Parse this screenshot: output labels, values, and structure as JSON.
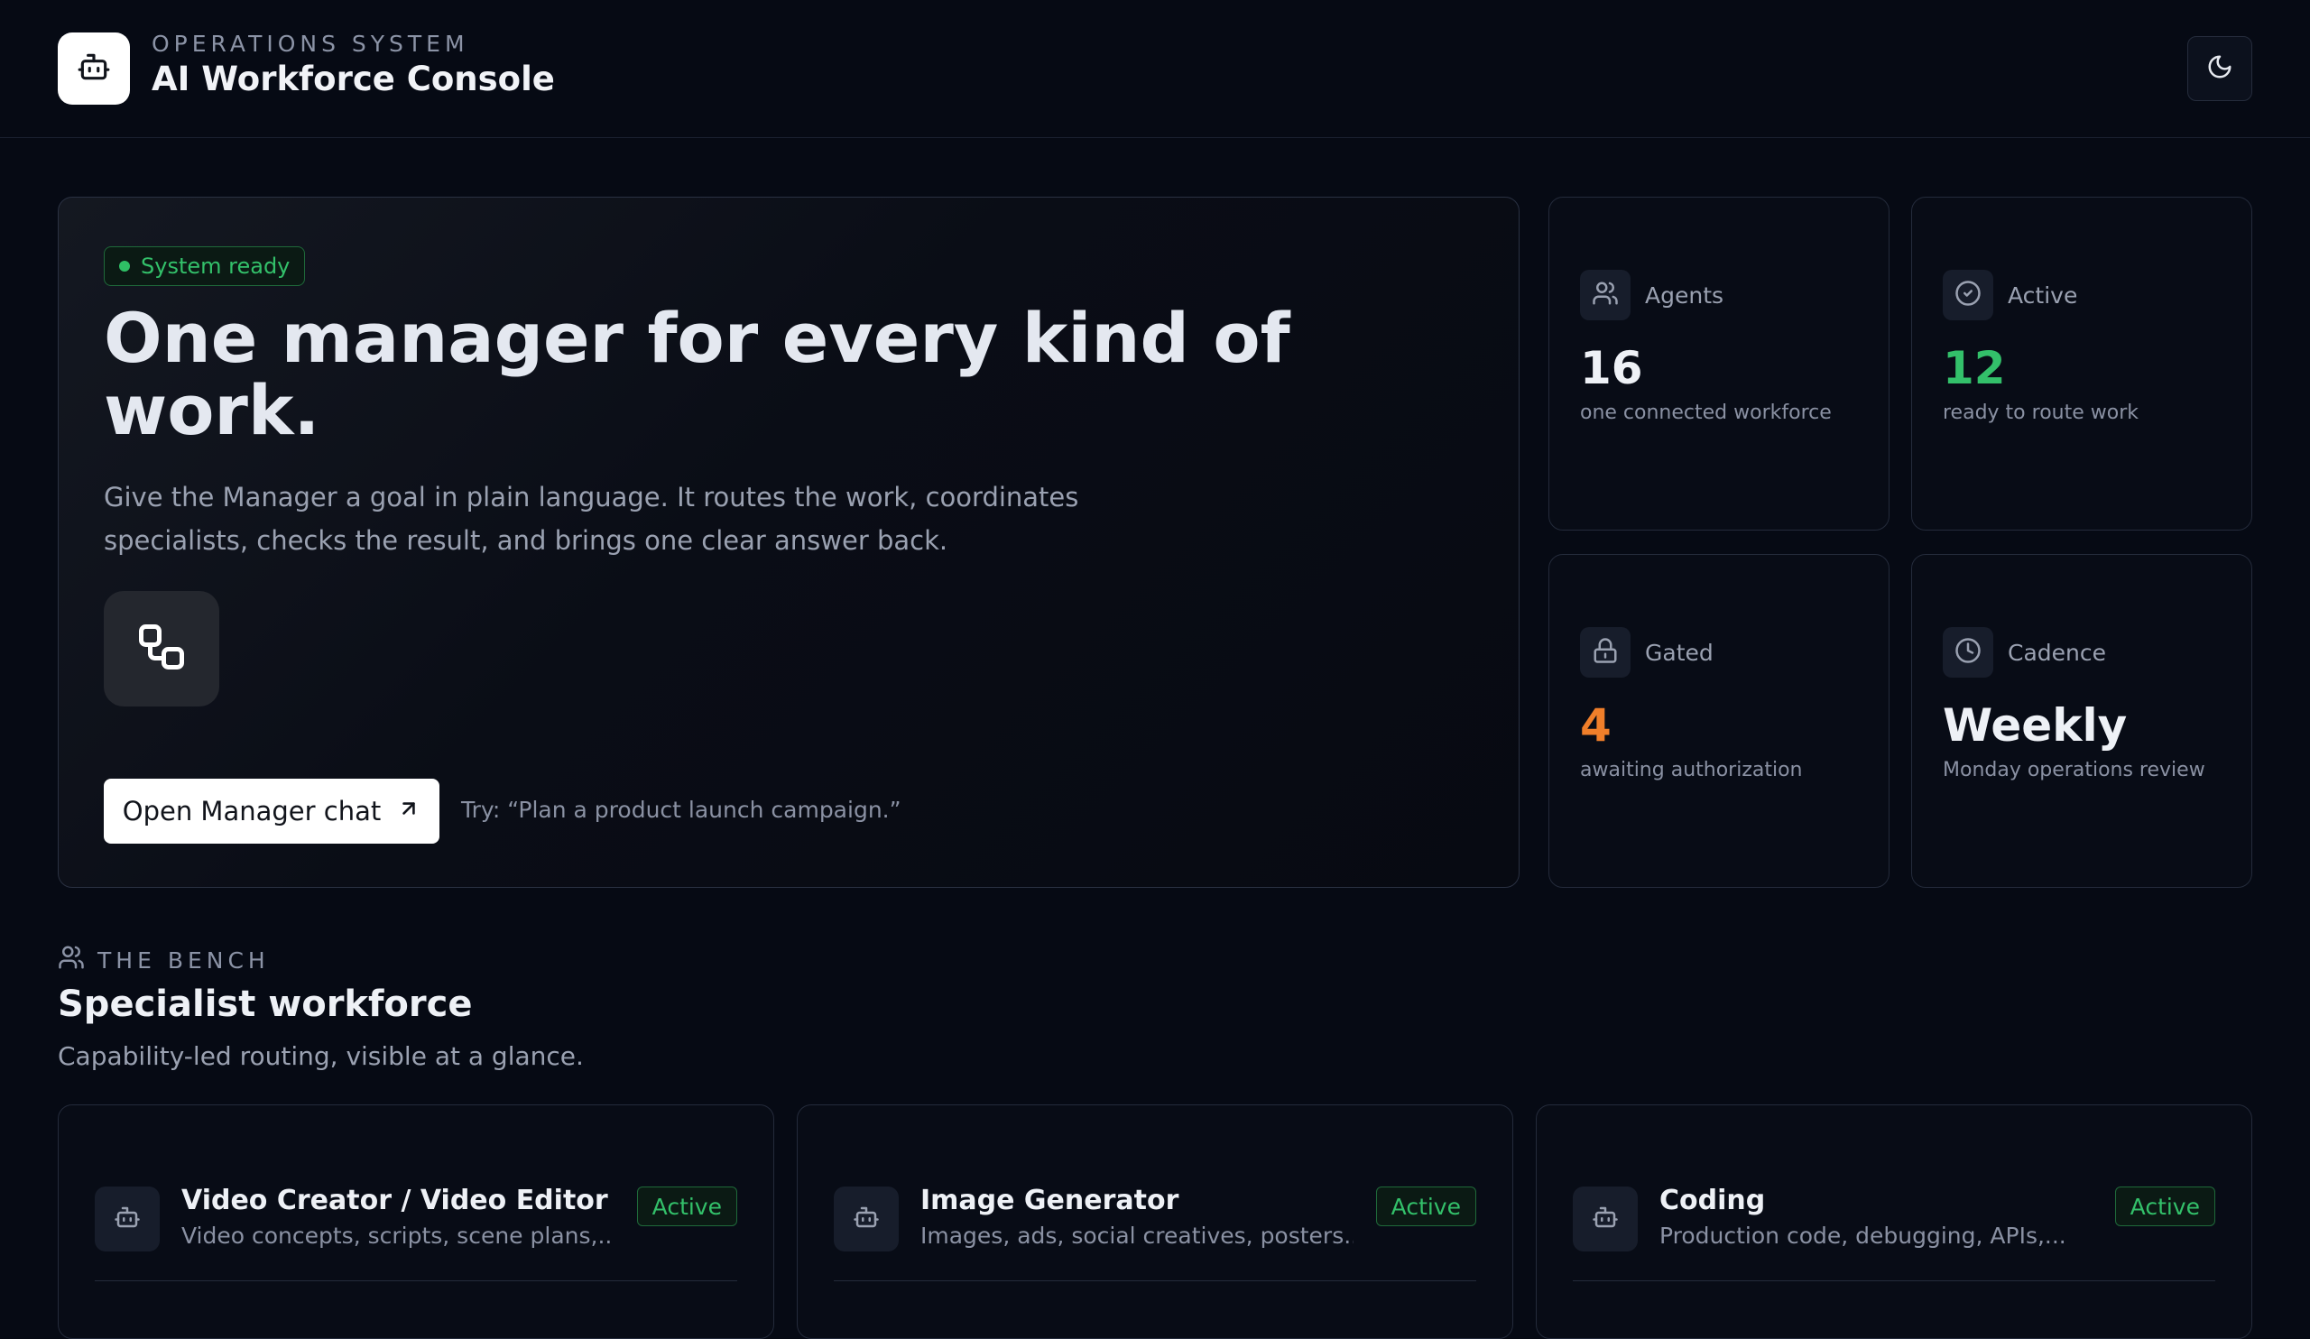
{
  "header": {
    "eyebrow": "OPERATIONS SYSTEM",
    "title": "AI Workforce Console",
    "logo_icon": "robot-icon",
    "theme_icon": "moon-icon"
  },
  "hero": {
    "badge": "System ready",
    "title": "One manager for every kind of work.",
    "description": "Give the Manager a goal in plain language. It routes the work, coordinates specialists, checks the result, and brings one clear answer back.",
    "icon": "workflow-icon",
    "cta_label": "Open Manager chat",
    "hint": "Try: “Plan a product launch campaign.”"
  },
  "stats": [
    {
      "label": "Agents",
      "value": "16",
      "sub": "one connected workforce",
      "icon": "users-icon",
      "color": "#eef1f6"
    },
    {
      "label": "Active",
      "value": "12",
      "sub": "ready to route work",
      "icon": "check-circle-icon",
      "color": "#33c06a"
    },
    {
      "label": "Gated",
      "value": "4",
      "sub": "awaiting authorization",
      "icon": "lock-icon",
      "color": "#f07f2a"
    },
    {
      "label": "Cadence",
      "value": "Weekly",
      "sub": "Monday operations review",
      "icon": "clock-icon",
      "color": "#eef1f6"
    }
  ],
  "bench": {
    "eyebrow": "THE BENCH",
    "title": "Specialist workforce",
    "subtitle": "Capability-led routing, visible at a glance."
  },
  "agents": [
    {
      "name": "Video Creator / Video Editor",
      "description": "Video concepts, scripts, scene plans,...",
      "status": "Active"
    },
    {
      "name": "Image Generator",
      "description": "Images, ads, social creatives, posters...",
      "status": "Active"
    },
    {
      "name": "Coding",
      "description": "Production code, debugging, APIs,...",
      "status": "Active"
    }
  ],
  "colors": {
    "accent_green": "#33c06a",
    "accent_orange": "#f07f2a",
    "background": "#060a14"
  }
}
